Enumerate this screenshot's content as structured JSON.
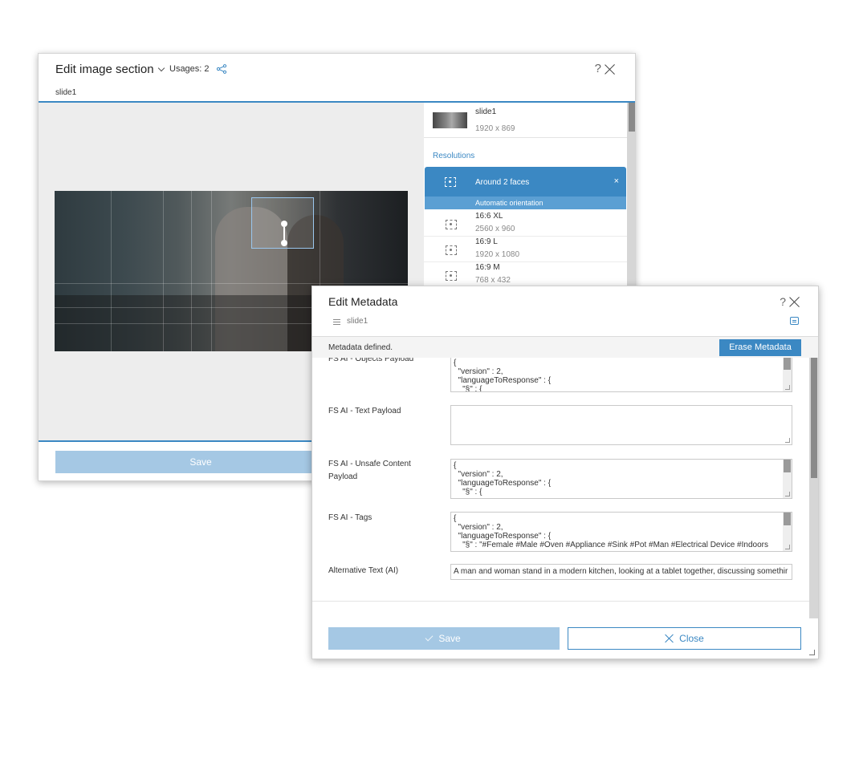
{
  "image_dialog": {
    "title": "Edit image section",
    "usages": "Usages: 2",
    "help": "?",
    "subtitle": "slide1",
    "save_label": "Save",
    "image_item": {
      "name": "slide1",
      "size": "1920 x 869"
    },
    "resolutions_label": "Resolutions",
    "active_resolution": {
      "label": "Around 2 faces",
      "sub": "Automatic orientation",
      "remove": "×"
    },
    "resolutions": [
      {
        "name": "16:6 XL",
        "size": "2560 x 960"
      },
      {
        "name": "16:9 L",
        "size": "1920 x 1080"
      },
      {
        "name": "16:9 M",
        "size": "768 x 432"
      }
    ]
  },
  "meta_dialog": {
    "title": "Edit Metadata",
    "help": "?",
    "subtitle": "slide1",
    "status": "Metadata defined.",
    "erase_label": "Erase Metadata",
    "fields": [
      {
        "label": "FS AI - Objects Payload",
        "value": "{\n  \"version\" : 2,\n  \"languageToResponse\" : {\n    \"§\" : {"
      },
      {
        "label": "FS AI - Text Payload",
        "value": ""
      },
      {
        "label": "FS AI - Unsafe Content\nPayload",
        "value": "{\n  \"version\" : 2,\n  \"languageToResponse\" : {\n    \"§\" : {"
      },
      {
        "label": "FS AI - Tags",
        "value": "{\n  \"version\" : 2,\n  \"languageToResponse\" : {\n    \"§\" : \"#Female #Male #Oven #Appliance #Sink #Pot #Man #Electrical Device #Indoors"
      }
    ],
    "alt_text": {
      "label": "Alternative Text (AI)",
      "value": "A man and woman stand in a modern kitchen, looking at a tablet together, discussing somethir"
    },
    "save_label": "Save",
    "close_label": "Close"
  },
  "colors": {
    "accent": "#3b88c3",
    "disabled_button": "#a5c8e4"
  }
}
